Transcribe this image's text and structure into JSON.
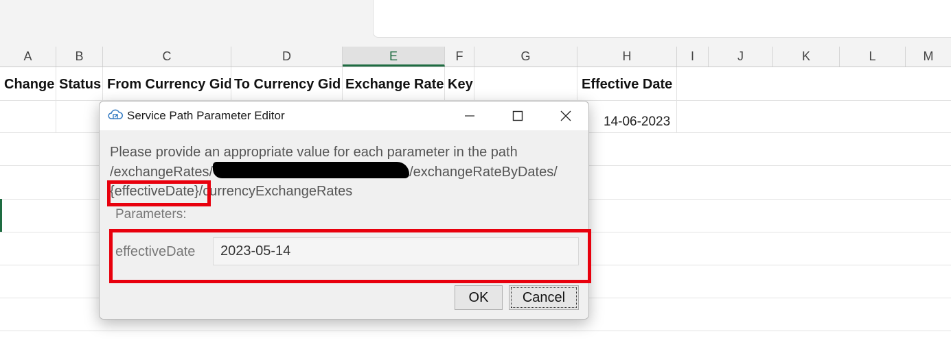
{
  "sheet": {
    "columns": [
      "A",
      "B",
      "C",
      "D",
      "E",
      "F",
      "G",
      "H",
      "I",
      "J",
      "K",
      "L",
      "M"
    ],
    "selected_column": "E",
    "header_row": [
      "Change",
      "Status",
      "From Currency Gid",
      "To Currency Gid",
      "Exchange Rate",
      "Key",
      "",
      "Effective Date"
    ],
    "data_row": {
      "effective_date": "14-06-2023"
    },
    "colors": {
      "selected_accent": "#1e6c41"
    }
  },
  "dialog": {
    "title": "Service Path Parameter Editor",
    "icon": "cloud-link-icon",
    "message_line1": "Please provide an appropriate value for each parameter in the path",
    "message_line2_prefix": "/exchangeRates/",
    "message_line2_suffix": "/exchangeRateByDates/",
    "message_line3_param": "{effectiveDate}/",
    "message_line3_rest": "currencyExchangeRates",
    "parameters_label": "Parameters:",
    "parameter_name": "effectiveDate",
    "parameter_value": "2023-05-14",
    "ok_label": "OK",
    "cancel_label": "Cancel",
    "highlight_color": "#e8000d"
  }
}
